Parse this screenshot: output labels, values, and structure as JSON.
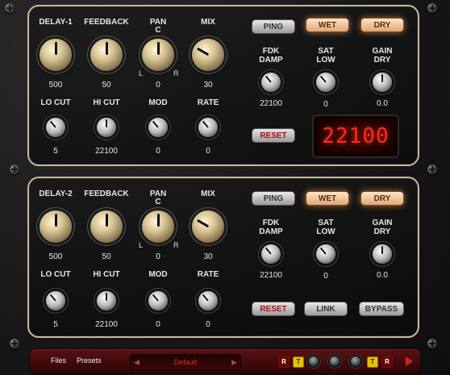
{
  "panel1": {
    "row1": [
      {
        "label": "DELAY-1",
        "value": "500",
        "rotation": 0
      },
      {
        "label": "FEEDBACK",
        "value": "50",
        "rotation": 0
      },
      {
        "label": "PAN",
        "value": "0",
        "rotation": 0
      },
      {
        "label": "MIX",
        "value": "30",
        "rotation": -60
      }
    ],
    "pan_center": "C",
    "pan_left": "L",
    "pan_right": "R",
    "row2": [
      {
        "label": "LO CUT",
        "value": "5",
        "rotation": -40
      },
      {
        "label": "HI CUT",
        "value": "22100",
        "rotation": 0
      },
      {
        "label": "MOD",
        "value": "0",
        "rotation": -40
      },
      {
        "label": "RATE",
        "value": "0",
        "rotation": -40
      }
    ],
    "right": [
      {
        "label1": "FDK",
        "label2": "DAMP",
        "value": "22100",
        "rotation": -40
      },
      {
        "label1": "SAT",
        "label2": "LOW",
        "value": "0",
        "rotation": -40
      },
      {
        "label1": "GAIN",
        "label2": "DRY",
        "value": "0.0",
        "rotation": 0
      }
    ],
    "ping_label": "PING",
    "wet_label": "WET",
    "dry_label": "DRY",
    "reset_label": "RESET",
    "lcd_value": "22100"
  },
  "panel2": {
    "row1": [
      {
        "label": "DELAY-2",
        "value": "500",
        "rotation": 0
      },
      {
        "label": "FEEDBACK",
        "value": "50",
        "rotation": 0
      },
      {
        "label": "PAN",
        "value": "0",
        "rotation": 0
      },
      {
        "label": "MIX",
        "value": "30",
        "rotation": -60
      }
    ],
    "pan_center": "C",
    "pan_left": "L",
    "pan_right": "R",
    "row2": [
      {
        "label": "LO CUT",
        "value": "5",
        "rotation": -40
      },
      {
        "label": "HI CUT",
        "value": "22100",
        "rotation": 0
      },
      {
        "label": "MOD",
        "value": "0",
        "rotation": -40
      },
      {
        "label": "RATE",
        "value": "0",
        "rotation": -40
      }
    ],
    "right": [
      {
        "label1": "FDK",
        "label2": "DAMP",
        "value": "22100",
        "rotation": -40
      },
      {
        "label1": "SAT",
        "label2": "LOW",
        "value": "0",
        "rotation": -40
      },
      {
        "label1": "GAIN",
        "label2": "DRY",
        "value": "0.0",
        "rotation": 0
      }
    ],
    "ping_label": "PING",
    "wet_label": "WET",
    "dry_label": "DRY",
    "reset_label": "RESET",
    "link_label": "LINK",
    "bypass_label": "BYPASS"
  },
  "bottombar": {
    "files_label": "Files",
    "presets_label": "Presets",
    "preset_name": "Default",
    "prev_arrow": "◀",
    "next_arrow": "▶",
    "leds": [
      "R",
      "T",
      "T",
      "R"
    ]
  },
  "colors": {
    "accent_red": "#ff2a1a",
    "panel_border": "#c9b89c",
    "wet_button": "#e0a674"
  }
}
